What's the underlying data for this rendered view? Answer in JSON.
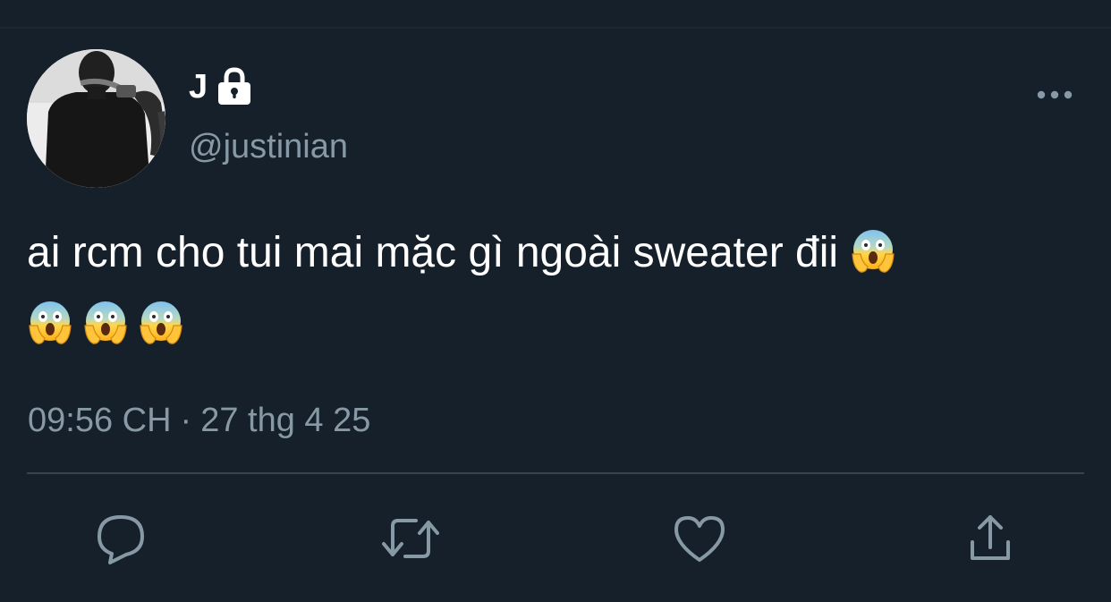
{
  "user": {
    "display_name": "J",
    "handle": "@justinian",
    "protected_icon": "lock-icon",
    "avatar_icon": "avatar"
  },
  "header": {
    "more_icon": "more-horizontal-icon"
  },
  "tweet": {
    "text": "ai rcm cho tui mai mặc gì ngoài sweater đii",
    "emoji": "screaming-face-emoji",
    "emoji_count_after_text": 1,
    "emoji_count_second_line": 3
  },
  "meta": {
    "time": "09:56 CH",
    "separator": "·",
    "date": "27 thg 4 25"
  },
  "actions": [
    {
      "name": "reply",
      "icon": "reply-icon"
    },
    {
      "name": "retweet",
      "icon": "retweet-icon"
    },
    {
      "name": "like",
      "icon": "heart-icon"
    },
    {
      "name": "share",
      "icon": "share-icon"
    }
  ],
  "colors": {
    "background": "#15202b",
    "primary_text": "#ffffff",
    "secondary_text": "#8899a6",
    "divider": "#38444d"
  }
}
